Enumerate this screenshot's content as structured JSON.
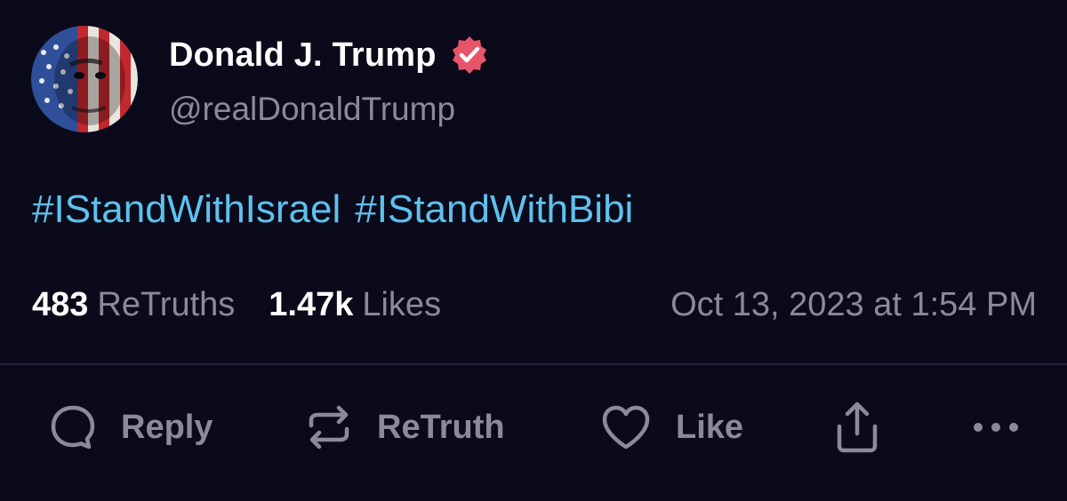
{
  "author": {
    "display_name": "Donald J. Trump",
    "handle": "@realDonaldTrump",
    "verified": true,
    "avatar_icon": "flag-portrait-avatar",
    "verified_icon": "verified-badge-icon"
  },
  "post": {
    "hashtags": [
      "#IStandWithIsrael",
      "#IStandWithBibi"
    ]
  },
  "stats": {
    "retruths_count": "483",
    "retruths_label": "ReTruths",
    "likes_count": "1.47k",
    "likes_label": "Likes",
    "timestamp": "Oct 13, 2023 at 1:54 PM"
  },
  "actions": {
    "reply": {
      "label": "Reply",
      "icon": "reply-icon"
    },
    "retruth": {
      "label": "ReTruth",
      "icon": "retruth-icon"
    },
    "like": {
      "label": "Like",
      "icon": "heart-icon"
    },
    "share": {
      "icon": "share-icon"
    },
    "more": {
      "icon": "more-icon"
    }
  },
  "colors": {
    "background": "#0b0a1a",
    "hashtag": "#5ec1ee",
    "muted": "#8a8a99",
    "verified": "#e8556b"
  }
}
